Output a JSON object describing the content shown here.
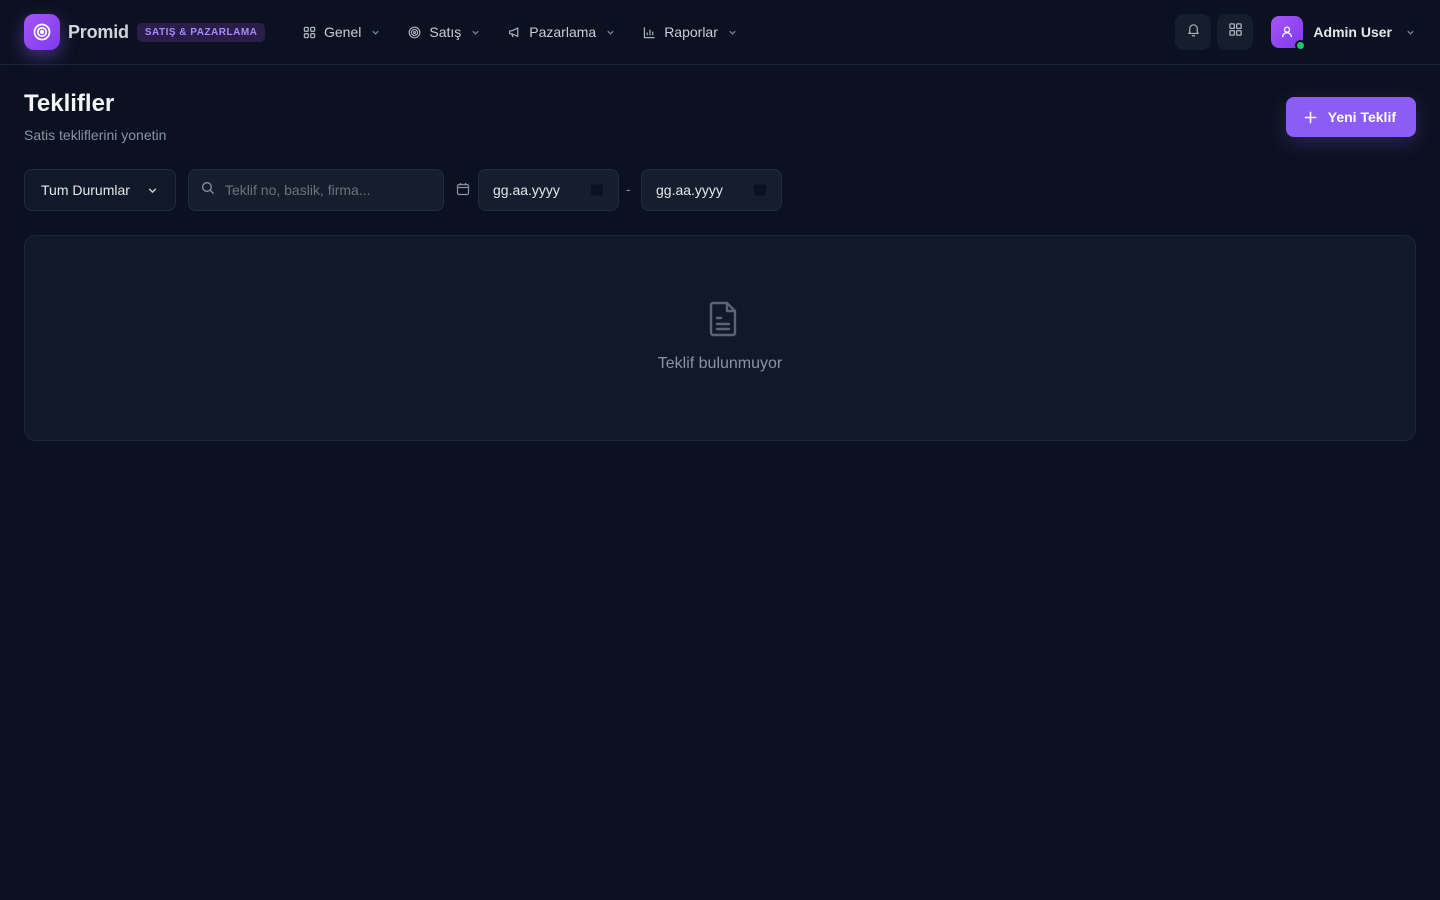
{
  "brand": {
    "name": "Promid",
    "badge": "SATIŞ & PAZARLAMA"
  },
  "nav": [
    {
      "label": "Genel",
      "icon": "grid-icon"
    },
    {
      "label": "Satış",
      "icon": "target-icon"
    },
    {
      "label": "Pazarlama",
      "icon": "megaphone-icon"
    },
    {
      "label": "Raporlar",
      "icon": "bar-chart-icon"
    }
  ],
  "user": {
    "name": "Admin User",
    "status": "online"
  },
  "header": {
    "title": "Teklifler",
    "subtitle": "Satis tekliflerini yonetin",
    "new_button": "Yeni Teklif"
  },
  "filters": {
    "status_selected": "Tum Durumlar",
    "search_placeholder": "Teklif no, baslik, firma...",
    "date_from": "gg.aa.yyyy",
    "date_to": "gg.aa.yyyy",
    "date_separator": "-"
  },
  "empty_state": {
    "message": "Teklif bulunmuyor"
  },
  "colors": {
    "background": "#0b1120",
    "accent": "#8b5cf6",
    "online": "#22c55e"
  }
}
